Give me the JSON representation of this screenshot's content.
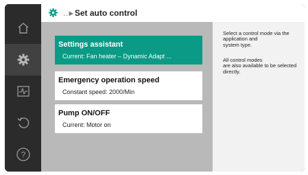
{
  "header": {
    "ellipsis": "..",
    "title": "Set auto control"
  },
  "sidebar": {
    "items": [
      {
        "icon": "home-icon",
        "active": false
      },
      {
        "icon": "gear-icon",
        "active": true
      },
      {
        "icon": "diagnostics-icon",
        "active": false
      },
      {
        "icon": "restore-icon",
        "active": false
      },
      {
        "icon": "help-icon",
        "active": false
      }
    ]
  },
  "menu": {
    "items": [
      {
        "title": "Settings assistant",
        "subtitle": "Current: Fan heater – Dynamic Adapt ...",
        "selected": true
      },
      {
        "title": "Emergency operation speed",
        "subtitle": "Constant speed: 2000/Min",
        "selected": false
      },
      {
        "title": "Pump ON/OFF",
        "subtitle": "Current: Motor on",
        "selected": false
      }
    ]
  },
  "help": {
    "paragraph1": "Select a control mode via the\napplication and\nsystem type.",
    "paragraph2": "All control modes\nare also available to be selected\ndirectly."
  },
  "colors": {
    "accent": "#0b9a86",
    "sidebar": "#2b2b2b",
    "sidebar_active": "#414141",
    "content_bg": "#b9b9b9",
    "help_bg": "#f2f2f2"
  }
}
